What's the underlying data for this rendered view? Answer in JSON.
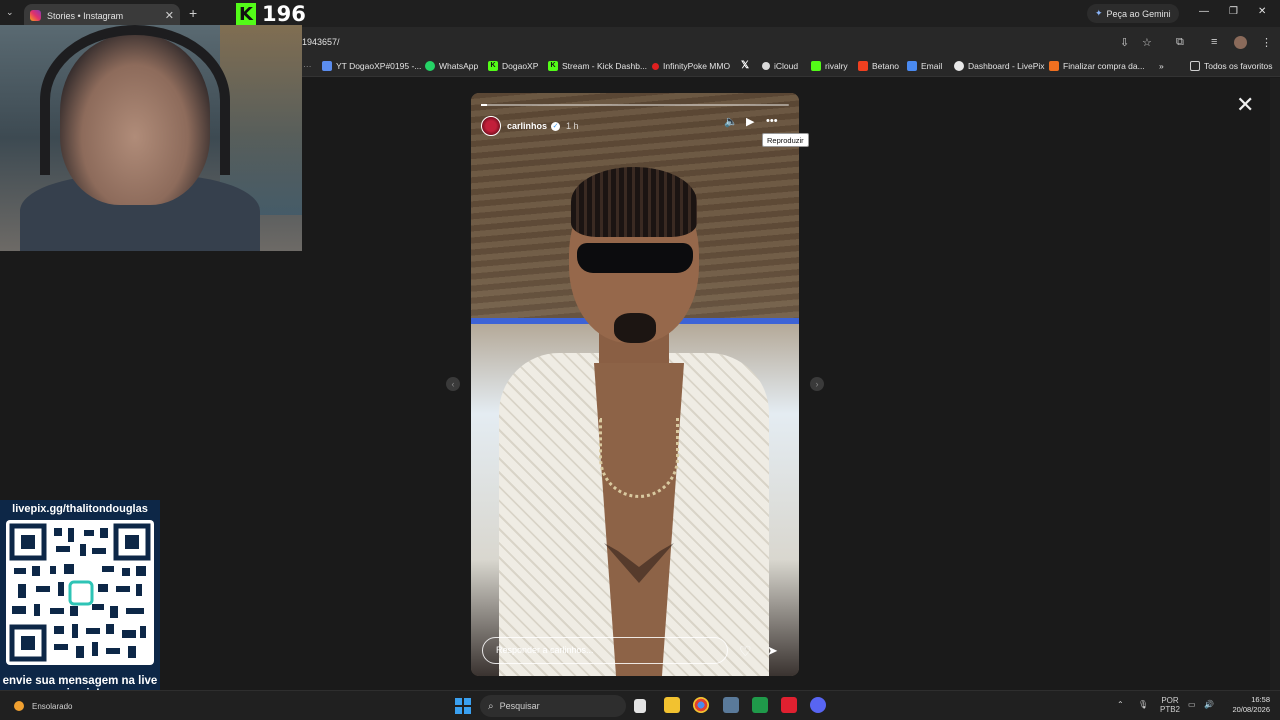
{
  "browser": {
    "tab_title": "Stories • Instagram",
    "url_fragment": "1943657/",
    "gemini_label": "Peça ao Gemini",
    "bookmarks": [
      {
        "label": "YT DogaoXP#0195 -...",
        "color": "#5b8def"
      },
      {
        "label": "WhatsApp",
        "color": "#25d366"
      },
      {
        "label": "DogaoXP",
        "color": "#53fc18"
      },
      {
        "label": "Stream - Kick Dashb...",
        "color": "#53fc18"
      },
      {
        "label": "InfinityPoke MMO",
        "color": "#e02020"
      },
      {
        "label": "",
        "color": "#ffffff"
      },
      {
        "label": "iCloud",
        "color": "#d9d9d9"
      },
      {
        "label": "rivalry",
        "color": "#53fc18"
      },
      {
        "label": "Betano",
        "color": "#f04020"
      },
      {
        "label": "Email",
        "color": "#4a8af0"
      },
      {
        "label": "Dashboard - LivePix",
        "color": "#e8e8e8"
      },
      {
        "label": "Finalizar compra da...",
        "color": "#f07020"
      }
    ],
    "all_bookmarks_label": "Todos os favoritos"
  },
  "overlay": {
    "kick_count": "196",
    "qr_top_text": "livepix.gg/thalitondouglas",
    "qr_bottom_text": "envie sua mensagem na live via pix!"
  },
  "story": {
    "username": "carlinhos",
    "time": "1 h",
    "tooltip": "Reproduzir",
    "reply_placeholder": "Responder a carlinhos...",
    "progress": 0.02
  },
  "taskbar": {
    "weather": "Ensolarado",
    "search_placeholder": "Pesquisar",
    "lang_line1": "POR",
    "lang_line2": "PTB2",
    "time": "16:58",
    "date": "20/08/2026"
  },
  "colors": {
    "kick_green": "#53fc18",
    "qr_panel": "#0d2747",
    "verified_blue": "#3897f0"
  }
}
